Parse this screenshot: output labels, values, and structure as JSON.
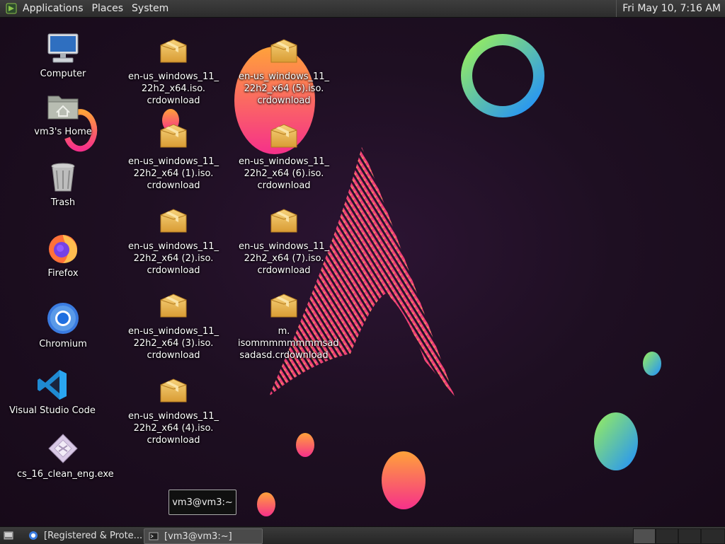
{
  "top_panel": {
    "menus": [
      "Applications",
      "Places",
      "System"
    ],
    "clock": "Fri May 10,  7:16 AM"
  },
  "desktop": {
    "left_icons": [
      {
        "label": "Computer",
        "icon": "computer-icon"
      },
      {
        "label": "vm3's Home",
        "icon": "home-folder-icon"
      },
      {
        "label": "Trash",
        "icon": "trash-icon"
      },
      {
        "label": "Firefox",
        "icon": "firefox-icon"
      },
      {
        "label": "Chromium",
        "icon": "chromium-icon"
      },
      {
        "label": "Visual Studio Code",
        "icon": "vscode-icon"
      },
      {
        "label": "cs_16_clean_eng.exe",
        "icon": "exe-file-icon"
      }
    ],
    "files": [
      {
        "label": "en-us_windows_11_\n22h2_x64.iso.\ncrdownload",
        "icon": "package-icon"
      },
      {
        "label": "en-us_windows_11_\n22h2_x64 (1).iso.\ncrdownload",
        "icon": "package-icon"
      },
      {
        "label": "en-us_windows_11_\n22h2_x64 (2).iso.\ncrdownload",
        "icon": "package-icon"
      },
      {
        "label": "en-us_windows_11_\n22h2_x64 (3).iso.\ncrdownload",
        "icon": "package-icon"
      },
      {
        "label": "en-us_windows_11_\n22h2_x64 (4).iso.\ncrdownload",
        "icon": "package-icon"
      },
      {
        "label": "en-us_windows_11_\n22h2_x64 (5).iso.\ncrdownload",
        "icon": "package-icon"
      },
      {
        "label": "en-us_windows_11_\n22h2_x64 (6).iso.\ncrdownload",
        "icon": "package-icon"
      },
      {
        "label": "en-us_windows_11_\n22h2_x64 (7).iso.\ncrdownload",
        "icon": "package-icon"
      },
      {
        "label": "m.\nisommmmmmmmsad\nsadasd.crdownload",
        "icon": "package-icon"
      }
    ]
  },
  "tooltip": "vm3@vm3:~",
  "taskbar": {
    "show_desktop_icon": "show-desktop-icon",
    "tasks": [
      {
        "label": "[Registered & Prote...",
        "icon": "browser-icon"
      },
      {
        "label": "[vm3@vm3:~]",
        "icon": "terminal-icon"
      }
    ],
    "workspaces": 4
  },
  "colors": {
    "panel": "#2e2e2e",
    "wallpaper": "#1e0f22",
    "arch_pink": "#e8306e",
    "arch_yellow": "#f6c445",
    "ring_green": "#8ef06a",
    "ring_blue": "#1e90ff",
    "folder": "#e7b44f"
  }
}
